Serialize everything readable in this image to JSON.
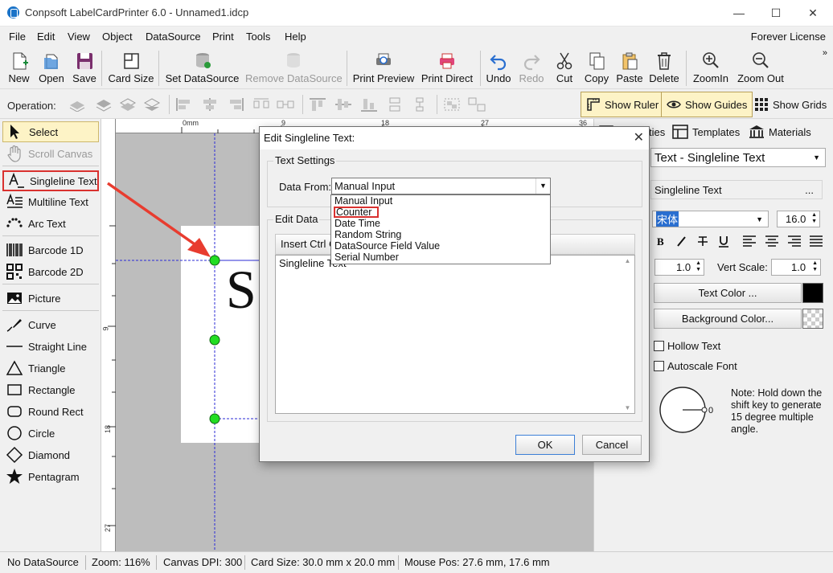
{
  "app": {
    "title": "Conpsoft LabelCardPrinter 6.0 - Unnamed1.idcp",
    "window_controls": [
      "minimize-icon",
      "maximize-icon",
      "close-icon"
    ]
  },
  "menubar": {
    "items": [
      "File",
      "Edit",
      "View",
      "Object",
      "DataSource",
      "Print",
      "Tools",
      "Help"
    ],
    "license": "Forever License"
  },
  "toolbar": {
    "new": "New",
    "open": "Open",
    "save": "Save",
    "card_size": "Card Size",
    "set_datasource": "Set DataSource",
    "remove_datasource": "Remove DataSource",
    "print_preview": "Print Preview",
    "print_direct": "Print Direct",
    "undo": "Undo",
    "redo": "Redo",
    "cut": "Cut",
    "copy": "Copy",
    "paste": "Paste",
    "delete": "Delete",
    "zoom_in": "ZoomIn",
    "zoom_out": "Zoom Out",
    "more": "»"
  },
  "operation_bar": {
    "label": "Operation:",
    "show_ruler": "Show Ruler",
    "show_guides": "Show Guides",
    "show_grids": "Show Grids"
  },
  "tools": {
    "select": "Select",
    "scroll_canvas": "Scroll Canvas",
    "singleline_text": "Singleline Text",
    "multiline_text": "Multiline Text",
    "arc_text": "Arc Text",
    "barcode_1d": "Barcode 1D",
    "barcode_2d": "Barcode 2D",
    "picture": "Picture",
    "curve": "Curve",
    "straight_line": "Straight Line",
    "triangle": "Triangle",
    "rectangle": "Rectangle",
    "round_rect": "Round Rect",
    "circle": "Circle",
    "diamond": "Diamond",
    "pentagram": "Pentagram"
  },
  "canvas": {
    "ruler_top": [
      "0mm",
      "9",
      "18",
      "27",
      "36"
    ],
    "ruler_left": [
      "9",
      "18",
      "27"
    ],
    "card_text": "S"
  },
  "right_panel": {
    "tabs": {
      "properties": "Properties",
      "templates": "Templates",
      "materials": "Materials"
    },
    "object_type": "Text - Singleline Text",
    "text_value": "Singleline Text",
    "ellipsis": "...",
    "font_name": "宋体",
    "font_size": "16.0",
    "horz_scale": "1.0",
    "vert_scale_label": "Vert Scale:",
    "vert_scale": "1.0",
    "text_color_button": "Text Color ...",
    "text_color": "#000000",
    "background_color_button": "Background Color...",
    "hollow_text": "Hollow Text",
    "autoscale_font": "Autoscale Font",
    "angle_value": "0",
    "note": "Note: Hold down the shift key to generate 15 degree multiple angle."
  },
  "statusbar": {
    "datasource": "No DataSource",
    "zoom": "Zoom: 116%",
    "dpi": "Canvas DPI: 300",
    "card_size": "Card Size: 30.0 mm x 20.0 mm",
    "mouse_pos": "Mouse Pos: 27.6 mm, 17.6 mm"
  },
  "dialog": {
    "title": "Edit Singleline Text:",
    "text_settings_group": "Text Settings",
    "data_from_label": "Data From:",
    "data_from_value": "Manual Input",
    "options": [
      "Manual Input",
      "Counter",
      "Date Time",
      "Random String",
      "DataSource Field Value",
      "Serial Number"
    ],
    "selected_option_index": 1,
    "edit_data_group": "Edit Data",
    "insert_button": "Insert Ctrl C",
    "edit_text": "Singleline Text",
    "ok": "OK",
    "cancel": "Cancel"
  },
  "colors": {
    "highlight_red": "#d9312f",
    "active_tool_bg": "#fdf3c6",
    "guide_blue": "#2b2bd6",
    "handle_green": "#22dd22"
  }
}
